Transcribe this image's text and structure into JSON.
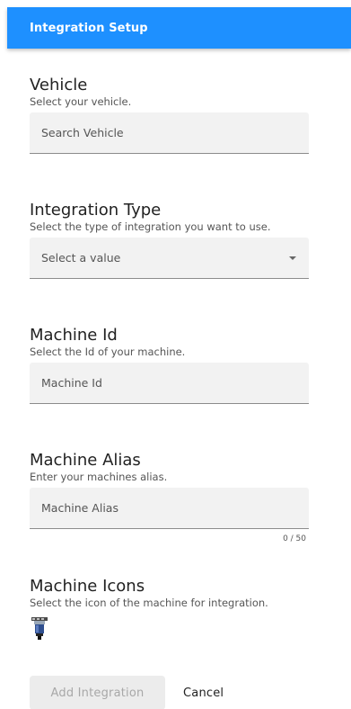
{
  "header": {
    "title": "Integration Setup",
    "color": "#1e90ff"
  },
  "vehicle": {
    "title": "Vehicle",
    "subtitle": "Select your vehicle.",
    "placeholder": "Search Vehicle"
  },
  "integration_type": {
    "title": "Integration Type",
    "subtitle": "Select the type of integration you want to use.",
    "selected_value": "Select a value",
    "caret_icon": "caret-down-icon"
  },
  "machine_id": {
    "title": "Machine Id",
    "subtitle": "Select the Id of your machine.",
    "placeholder": "Machine Id"
  },
  "machine_alias": {
    "title": "Machine Alias",
    "subtitle": "Enter your machines alias.",
    "placeholder": "Machine Alias",
    "counter": "0 / 50"
  },
  "machine_icons": {
    "title": "Machine Icons",
    "subtitle": "Select the icon of the machine for integration.",
    "icon_name": "drill-machine-icon"
  },
  "actions": {
    "add_label": "Add Integration",
    "cancel_label": "Cancel"
  }
}
